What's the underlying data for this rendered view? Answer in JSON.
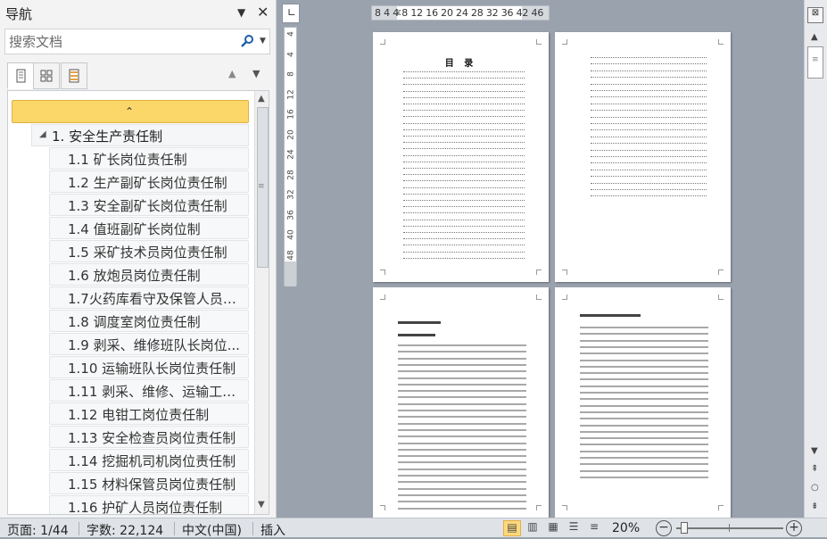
{
  "nav": {
    "title": "导航",
    "search_placeholder": "搜索文档",
    "tabs": [
      {
        "name": "headings",
        "icon": "document-headings-icon"
      },
      {
        "name": "pages",
        "icon": "page-thumbnails-icon"
      },
      {
        "name": "results",
        "icon": "search-results-icon"
      }
    ],
    "heading1": "1. 安全生产责任制",
    "headings2": [
      "1.1 矿长岗位责任制",
      "1.2 生产副矿长岗位责任制",
      "1.3 安全副矿长岗位责任制",
      "1.4 值班副矿长岗位制",
      "1.5 采矿技术员岗位责任制",
      "1.6 放炮员岗位责任制",
      "1.7火药库看守及保管人员岗...",
      "1.8 调度室岗位责任制",
      "1.9 剥采、维修班队长岗位...",
      "1.10 运输班队长岗位责任制",
      "1.11 剥采、维修、运输工种...",
      "1.12 电钳工岗位责任制",
      "1.13 安全检查员岗位责任制",
      "1.14 挖掘机司机岗位责任制",
      "1.15 材料保管员岗位责任制",
      "1.16 护矿人员岗位责任制"
    ]
  },
  "rulers": {
    "horizontal": "8  4    4  8  12 16 20 24 28 32 36    42 46",
    "vertical": [
      "4",
      "4",
      "8",
      "12",
      "16",
      "20",
      "24",
      "28",
      "32",
      "36",
      "40",
      "48"
    ]
  },
  "document": {
    "toc_title": "目 录"
  },
  "status": {
    "page": "页面: 1/44",
    "words": "字数: 22,124",
    "language": "中文(中国)",
    "mode": "插入",
    "zoom": "20%",
    "zoom_percent": 20
  },
  "colors": {
    "accent": "#fbd76a",
    "workspace": "#9aa3ad"
  }
}
